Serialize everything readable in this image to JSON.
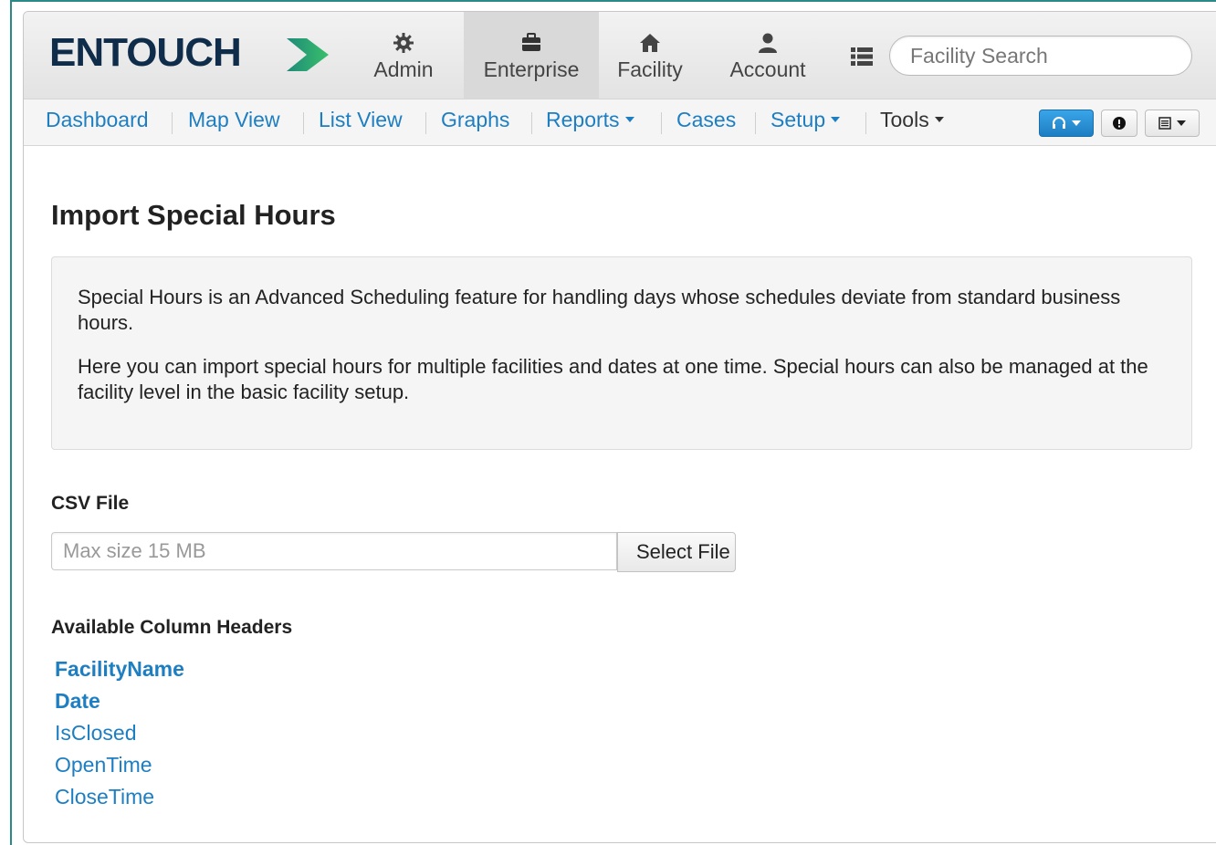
{
  "brand": {
    "logo_text": "ENTOUCH"
  },
  "top_nav": {
    "tabs": [
      {
        "label": "Admin",
        "icon": "gear-icon"
      },
      {
        "label": "Enterprise",
        "icon": "briefcase-icon",
        "active": true
      },
      {
        "label": "Facility",
        "icon": "home-icon"
      },
      {
        "label": "Account",
        "icon": "user-icon"
      }
    ],
    "search_placeholder": "Facility Search"
  },
  "sub_nav": {
    "items": [
      {
        "label": "Dashboard"
      },
      {
        "label": "Map View"
      },
      {
        "label": "List View"
      },
      {
        "label": "Graphs"
      },
      {
        "label": "Reports",
        "dropdown": true
      },
      {
        "label": "Cases"
      },
      {
        "label": "Setup",
        "dropdown": true
      },
      {
        "label": "Tools",
        "dropdown": true
      }
    ],
    "right_buttons": [
      "headset-icon",
      "alert-icon",
      "list-menu-icon"
    ]
  },
  "page": {
    "title": "Import Special Hours",
    "info": [
      "Special Hours is an Advanced Scheduling feature for handling days whose schedules deviate from standard business hours.",
      "Here you can import special hours for multiple facilities and dates at one time. Special hours can also be managed at the facility level in the basic facility setup."
    ],
    "csv_label": "CSV File",
    "file_placeholder": "Max size 15 MB",
    "select_file_label": "Select File",
    "columns_label": "Available Column Headers",
    "columns": [
      {
        "name": "FacilityName",
        "required": true
      },
      {
        "name": "Date",
        "required": true
      },
      {
        "name": "IsClosed",
        "required": false
      },
      {
        "name": "OpenTime",
        "required": false
      },
      {
        "name": "CloseTime",
        "required": false
      }
    ]
  },
  "colors": {
    "link": "#1d7ec2",
    "brand_navy": "#0f2d4a",
    "brand_green": "#2aa86f",
    "teal": "#2b8a88"
  }
}
